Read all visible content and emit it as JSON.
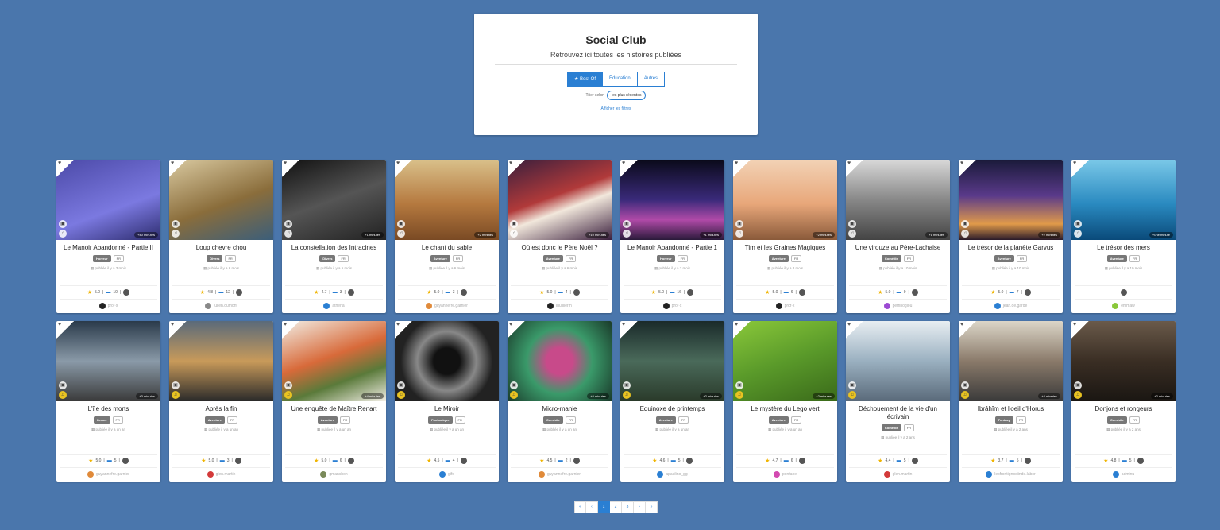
{
  "header": {
    "title": "Social Club",
    "subtitle": "Retrouvez ici toutes les histoires publiées",
    "tabs": [
      "Best Of",
      "Éducation",
      "Autres"
    ],
    "sort_label": "Trier selon",
    "sort_value": "les plus récentes",
    "filters_link": "Afficher les filtres"
  },
  "icons": {
    "heart": "heart-icon",
    "star": "star-icon",
    "comment": "comment-icon",
    "badge": "badge-icon",
    "music": "music-icon",
    "image": "image-icon"
  },
  "colors": {
    "background": "#4a76ac",
    "accent": "#2a7fd3",
    "star": "#f0b400"
  },
  "cards": [
    {
      "title": "Le Manoir Abandonné - Partie II",
      "genre": "Horreur",
      "lang": "FR",
      "published": "publiée il y a 3 mois",
      "rating": "5.0",
      "comments": "10",
      "author": "prof·x",
      "duration": "+40 minutes",
      "bg": "linear-gradient(160deg,#4c4aa8,#7b79e0 60%,#2d2c6e)",
      "avatar": "#222"
    },
    {
      "title": "Loup chevre chou",
      "genre": "Divers",
      "lang": "FR",
      "published": "publiée il y a 6 mois",
      "rating": "4.8",
      "comments": "12",
      "author": "julien.dumont",
      "duration": "",
      "bg": "linear-gradient(160deg,#d9c9a0,#8a6d3b 55%,#3b5e7a)",
      "avatar": "#888"
    },
    {
      "title": "La constellation des Intracines",
      "genre": "Divers",
      "lang": "FR",
      "published": "publiée il y a 5 mois",
      "rating": "4.7",
      "comments": "3",
      "author": "athena",
      "duration": "+1 minutes",
      "bg": "linear-gradient(160deg,#111,#555 50%,#222)",
      "avatar": "#2a7fd3"
    },
    {
      "title": "Le chant du sable",
      "genre": "Aventure",
      "lang": "FR",
      "published": "publiée il y a 6 mois",
      "rating": "5.0",
      "comments": "3",
      "author": "guyannefre.garnier",
      "duration": "+2 minutes",
      "bg": "linear-gradient(180deg,#d9c08a,#b5793f 55%,#7a4a24)",
      "avatar": "#e08a3a"
    },
    {
      "title": "Où est donc le Père Noël ?",
      "genre": "Aventure",
      "lang": "FR",
      "published": "publiée il y a 6 mois",
      "rating": "5.0",
      "comments": "4",
      "author": "lhuillierm",
      "duration": "+10 minutes",
      "bg": "linear-gradient(160deg,#3a1f3d,#b13a3a 45%,#f2e8dc 60%,#3a1f3d)",
      "avatar": "#222"
    },
    {
      "title": "Le Manoir Abandonné - Partie 1",
      "genre": "Horreur",
      "lang": "FR",
      "published": "publiée il y a 7 mois",
      "rating": "5.0",
      "comments": "16",
      "author": "prof·x",
      "duration": "+1 minutes",
      "bg": "linear-gradient(180deg,#0a0a1a,#3a2a7a 50%,#b04aa8 75%,#2a1a3a)",
      "avatar": "#222"
    },
    {
      "title": "Tim et les Graines Magiques",
      "genre": "Aventure",
      "lang": "FR",
      "published": "publiée il y a 8 mois",
      "rating": "5.0",
      "comments": "6",
      "author": "prof·x",
      "duration": "+2 minutes",
      "bg": "linear-gradient(180deg,#f2d2b5,#e8a77a 55%,#8a5a3a)",
      "avatar": "#222"
    },
    {
      "title": "Une virouze au Père-Lachaise",
      "genre": "Comédie",
      "lang": "FR",
      "published": "publiée il y a 10 mois",
      "rating": "5.0",
      "comments": "9",
      "author": "petrinoglou",
      "duration": "+1 minutes",
      "bg": "linear-gradient(180deg,#d8d8d8,#888 50%,#444)",
      "avatar": "#9c4ad3"
    },
    {
      "title": "Le trésor de la planète Garvus",
      "genre": "Aventure",
      "lang": "FR",
      "published": "publiée il y a 10 mois",
      "rating": "5.0",
      "comments": "7",
      "author": "jean.de.garde",
      "duration": "+2 minutes",
      "bg": "linear-gradient(180deg,#1a1a3a,#5a3a8a 45%,#e09a4a 80%,#2a1a2a)",
      "avatar": "#2a7fd3"
    },
    {
      "title": "Le trésor des mers",
      "genre": "Aventure",
      "lang": "FR",
      "published": "publiée il y a 10 mois",
      "rating": "",
      "comments": "",
      "author": "emmaw",
      "duration": "+une minute",
      "bg": "linear-gradient(180deg,#7ac8e8,#2a8ac0 55%,#0a4a7a)",
      "avatar": "#8ac83a"
    },
    {
      "title": "L'île des morts",
      "genre": "Drame",
      "lang": "FR",
      "published": "publiée il y a un an",
      "rating": "5.0",
      "comments": "5",
      "author": "guyannefre.garnier",
      "duration": "+3 minutes",
      "bg": "linear-gradient(180deg,#2a3a4a,#8a9aa8 50%,#3a3a3a)",
      "avatar": "#e08a3a"
    },
    {
      "title": "Après la fin",
      "genre": "Aventure",
      "lang": "FR",
      "published": "publiée il y a un an",
      "rating": "5.0",
      "comments": "3",
      "author": "glen.martin",
      "duration": "",
      "bg": "linear-gradient(180deg,#5a6a7a,#c89a5a 50%,#2a2a2a)",
      "avatar": "#d33a3a"
    },
    {
      "title": "Une enquête de Maître Renart",
      "genre": "Aventure",
      "lang": "FR",
      "published": "publiée il y a un an",
      "rating": "5.0",
      "comments": "6",
      "author": "gmanchon",
      "duration": "+4 minutes",
      "bg": "linear-gradient(160deg,#f2eee5,#d86a3a 45%,#5a7a3a 70%,#f2eee5)",
      "avatar": "#7a8a5a"
    },
    {
      "title": "Le Miroir",
      "genre": "Fantastique",
      "lang": "FR",
      "published": "publiée il y a un an",
      "rating": "4.5",
      "comments": "4",
      "author": "gifo",
      "duration": "",
      "bg": "radial-gradient(circle,#111 20%,#888 45%,#222 70%)",
      "avatar": "#2a7fd3"
    },
    {
      "title": "Micro-manie",
      "genre": "Comédie",
      "lang": "FR",
      "published": "publiée il y a un an",
      "rating": "4.5",
      "comments": "2",
      "author": "guyannefre.garnier",
      "duration": "+5 minutes",
      "bg": "radial-gradient(circle,#c84a8a 20%,#3a9a6a 50%,#1a3a2a)",
      "avatar": "#e08a3a"
    },
    {
      "title": "Equinoxe de printemps",
      "genre": "Aventure",
      "lang": "FR",
      "published": "publiée il y a un an",
      "rating": "4.6",
      "comments": "5",
      "author": "apaulino_gg",
      "duration": "+2 minutes",
      "bg": "linear-gradient(180deg,#1a2a2a,#4a6a5a 50%,#2a3a2a)",
      "avatar": "#2a7fd3"
    },
    {
      "title": "Le mystère du Lego vert",
      "genre": "Aventure",
      "lang": "FR",
      "published": "publiée il y a un an",
      "rating": "4.7",
      "comments": "6",
      "author": "pontane",
      "duration": "+2 minutes",
      "bg": "linear-gradient(160deg,#8ac83a,#5a9a2a 50%,#3a6a1a)",
      "avatar": "#d34ab0"
    },
    {
      "title": "Déchouement de la vie d'un écrivain",
      "genre": "Comédie",
      "lang": "FR",
      "published": "publiée il y a 2 ans",
      "rating": "4.4",
      "comments": "5",
      "author": "glen.martin",
      "duration": "",
      "bg": "linear-gradient(180deg,#e8eef2,#9ab0c0 50%,#5a6a7a)",
      "avatar": "#d33a3a"
    },
    {
      "title": "Ibrâhîm et l'oeil d'Horus",
      "genre": "Fantasy",
      "lang": "FR",
      "published": "publiée il y a 2 ans",
      "rating": "3.7",
      "comments": "5",
      "author": "lesfrontignosiinde.labor",
      "duration": "+4 minutes",
      "bg": "linear-gradient(180deg,#dcd6c8,#8a7a6a 50%,#3a3a3a)",
      "avatar": "#2a7fd3"
    },
    {
      "title": "Donjons et rongeurs",
      "genre": "Comédie",
      "lang": "FR",
      "published": "publiée il y a 2 ans",
      "rating": "4.8",
      "comments": "5",
      "author": "adminu",
      "duration": "+2 minutes",
      "bg": "linear-gradient(180deg,#6a5a4a,#3a2e24 50%,#1a1612)",
      "avatar": "#2a7fd3"
    }
  ],
  "pagination": [
    "«",
    "‹",
    "1",
    "2",
    "3",
    "›",
    "»"
  ],
  "pagination_active": "1"
}
